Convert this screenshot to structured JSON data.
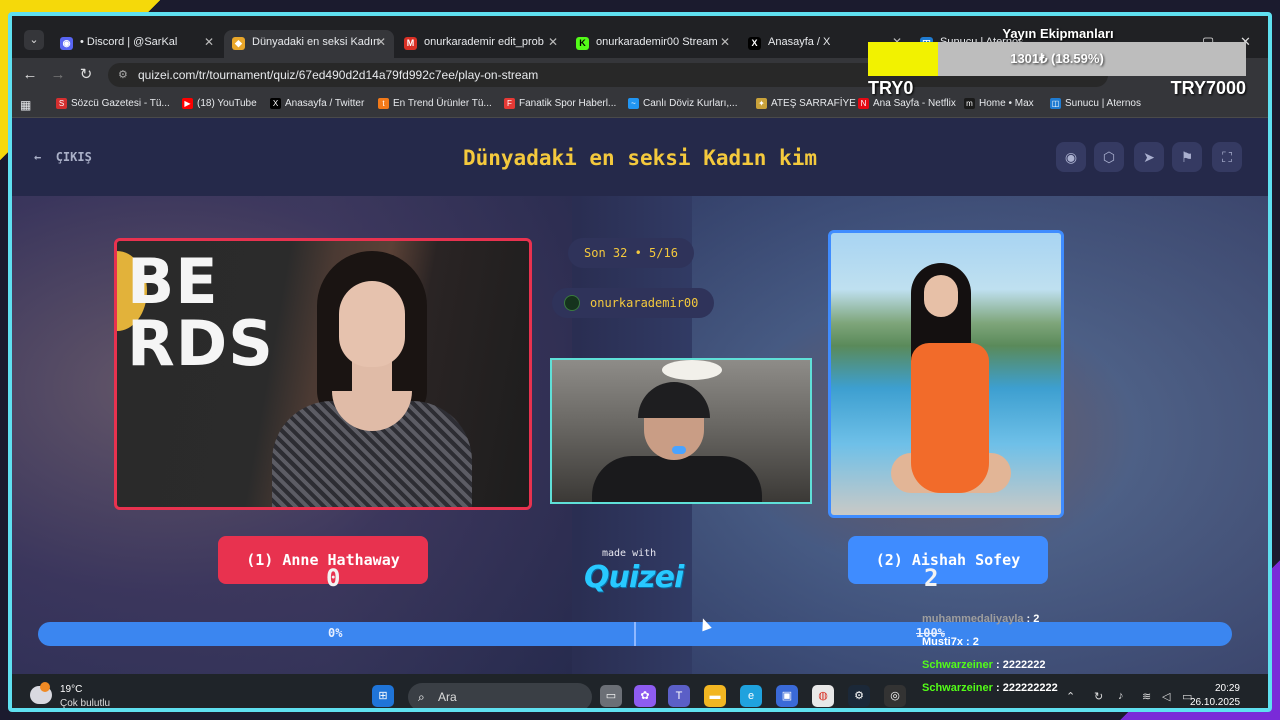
{
  "browser": {
    "tabs": [
      {
        "title": "• Discord | @SarKal",
        "icon": "discord-icon",
        "color": "#5865f2"
      },
      {
        "title": "Dünyadaki en seksi Kadın",
        "icon": "quizei-icon",
        "color": "#e8a62a"
      },
      {
        "title": "onurkarademir edit_prob",
        "icon": "gmail-icon",
        "color": "#d93025"
      },
      {
        "title": "onurkarademir00 Stream",
        "icon": "kick-icon",
        "color": "#53fc18"
      },
      {
        "title": "Anasayfa / X",
        "icon": "x-icon",
        "color": "#000000"
      },
      {
        "title": "Sunucu | Aternos",
        "icon": "aternos-icon",
        "color": "#1f7bd1"
      }
    ],
    "url": "quizei.com/tr/tournament/quiz/67ed490d2d14a79fd992c7ee/play-on-stream",
    "bookmarks": [
      {
        "label": "Sözcü Gazetesi - Tü...",
        "icon": "sozcu-icon",
        "color": "#d32f2f"
      },
      {
        "label": "(18) YouTube",
        "icon": "youtube-icon",
        "color": "#ff0000"
      },
      {
        "label": "Anasayfa / Twitter",
        "icon": "x-icon",
        "color": "#000000"
      },
      {
        "label": "En Trend Ürünler Tü...",
        "icon": "trendyol-icon",
        "color": "#f27a1a"
      },
      {
        "label": "Fanatik Spor Haberl...",
        "icon": "fanatik-icon",
        "color": "#e53935"
      },
      {
        "label": "Canlı Döviz Kurları,...",
        "icon": "chart-icon",
        "color": "#2196f3"
      },
      {
        "label": "ATEŞ SARRAFİYE",
        "icon": "gem-icon",
        "color": "#c9a23a"
      },
      {
        "label": "Ana Sayfa - Netflix",
        "icon": "netflix-icon",
        "color": "#e50914"
      },
      {
        "label": "Home • Max",
        "icon": "max-icon",
        "color": "#1a1a1a"
      },
      {
        "label": "Sunucu | Aternos",
        "icon": "aternos-icon",
        "color": "#1f7bd1"
      }
    ]
  },
  "quiz": {
    "back_label": "ÇIKIŞ",
    "title": "Dünyadaki en seksi Kadın kim",
    "round_badge": "Son 32 • 5/16",
    "streamer": "onurkarademir00",
    "left": {
      "label": "(1) Anne Hathaway",
      "score": "0"
    },
    "right": {
      "label": "(2) Aishah Sofey",
      "score": "2"
    },
    "made_with": "made with",
    "logo": "Quizei",
    "progress": {
      "left_pct": "0%",
      "right_pct": "100%",
      "left_fraction": 0,
      "right_fraction": 1
    }
  },
  "taskbar": {
    "temperature": "19°C",
    "condition": "Çok bulutlu",
    "search_placeholder": "Ara",
    "time": "20:29",
    "date": "26.10.2025"
  },
  "donation_goal": {
    "title": "Yayın Ekipmanları",
    "amount": "1301₺ (18.59%)",
    "min": "TRY0",
    "max": "TRY7000",
    "fraction": 0.1859
  },
  "chat": [
    {
      "user": "muhammedaliyayla",
      "message": "2",
      "color": "#9e9e9e"
    },
    {
      "user": "Musti7x",
      "message": "2",
      "color": "#ffffff"
    },
    {
      "user": "Schwarzeiner",
      "message": "2222222",
      "color": "#53fc18"
    },
    {
      "user": "Schwarzeiner",
      "message": "222222222",
      "color": "#53fc18"
    }
  ]
}
